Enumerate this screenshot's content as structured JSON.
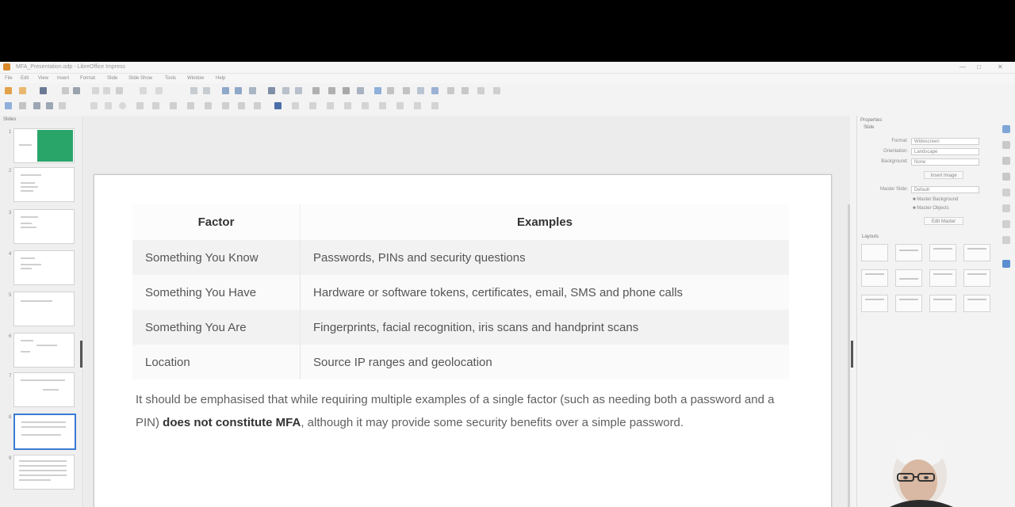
{
  "window": {
    "title": "MFA_Presentation.odp - LibreOffice Impress",
    "controls": [
      "—",
      "□",
      "✕"
    ]
  },
  "menu": [
    "File",
    "Edit",
    "View",
    "Insert",
    "Format",
    "Slide",
    "Slide Show",
    "Tools",
    "Window",
    "Help"
  ],
  "slides_panel": {
    "title": "Slides",
    "slide_numbers": [
      "1",
      "2",
      "3",
      "4",
      "5",
      "6",
      "7",
      "8",
      "9"
    ],
    "selected_index": 8
  },
  "slide": {
    "table": {
      "headers": [
        "Factor",
        "Examples"
      ],
      "rows": [
        {
          "factor": "Something You Know",
          "examples": "Passwords, PINs and security questions"
        },
        {
          "factor": "Something You Have",
          "examples": "Hardware or software tokens, certificates, email, SMS and phone calls"
        },
        {
          "factor": "Something You Are",
          "examples": "Fingerprints, facial recognition, iris scans and handprint scans"
        },
        {
          "factor": "Location",
          "examples": "Source IP ranges and geolocation"
        }
      ]
    },
    "note": {
      "before": "It should be emphasised that while requiring multiple examples of a single factor (such as needing both a password and a PIN) ",
      "bold": "does not constitute MFA",
      "after": ", although it may provide some security benefits over a simple password."
    }
  },
  "sidebar": {
    "properties_title": "Properties",
    "slide_section": "Slide",
    "format_label": "Format:",
    "format_value": "Widescreen",
    "orientation_label": "Orientation:",
    "orientation_value": "Landscape",
    "background_label": "Background:",
    "background_value": "None",
    "insert_image_label": "Insert Image",
    "master_slide_label": "Master Slide:",
    "master_slide_value": "Default",
    "master_background_label": "Master Background",
    "master_objects_label": "Master Objects",
    "edit_master_label": "Edit Master",
    "layouts_title": "Layouts"
  },
  "colors": {
    "accent": "#3a7bd5",
    "title_slide_green": "#2aa56a"
  }
}
